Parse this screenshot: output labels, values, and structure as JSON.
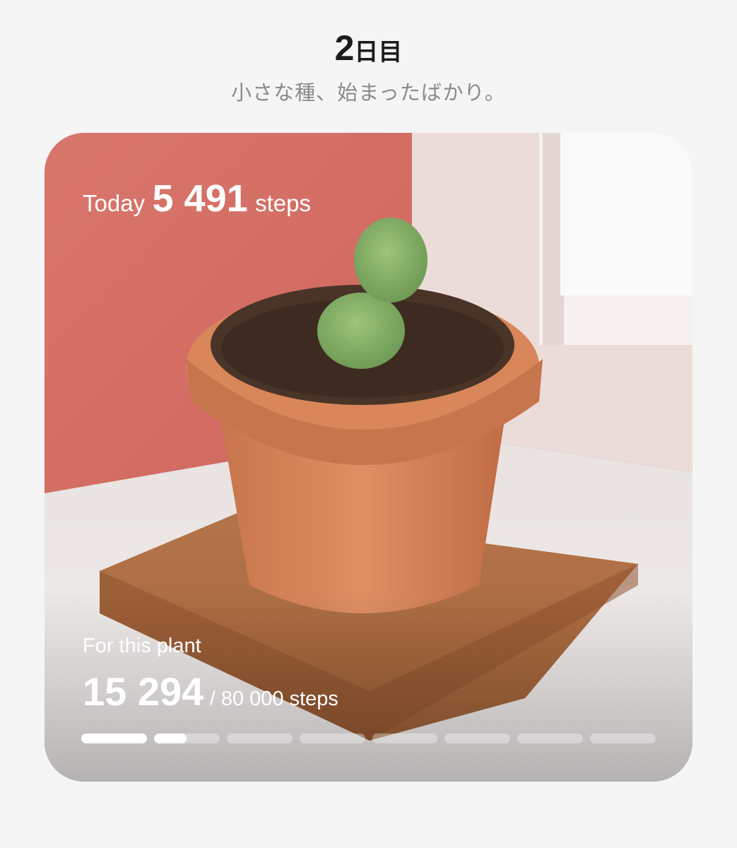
{
  "header": {
    "day_number": "2",
    "day_unit": "日目",
    "subtitle": "小さな種、始まったばかり。"
  },
  "card": {
    "today_label": "Today",
    "today_steps": "5 491",
    "today_unit": "steps",
    "plant_label": "For this plant",
    "plant_steps": "15 294",
    "plant_goal": "/ 80 000 steps",
    "segments": [
      1,
      0.5,
      0,
      0,
      0,
      0,
      0,
      0
    ],
    "image_icon": "potted-cactus-illustration"
  }
}
